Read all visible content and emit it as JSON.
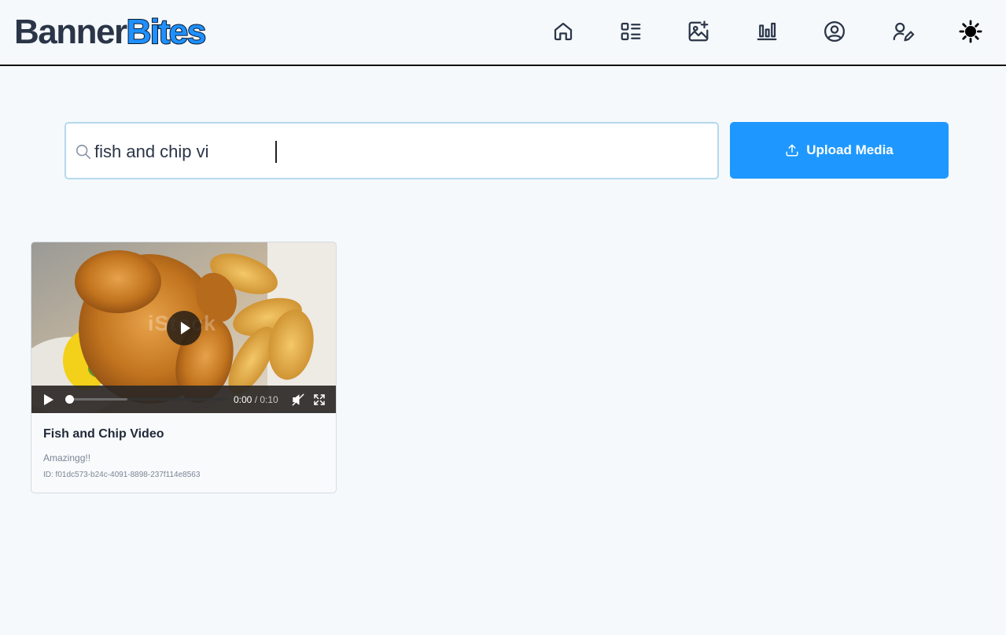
{
  "app": {
    "logo_part1": "Banner",
    "logo_part2": "Bites"
  },
  "nav": [
    {
      "name": "home-icon"
    },
    {
      "name": "dashboard-list-icon"
    },
    {
      "name": "image-add-icon"
    },
    {
      "name": "bar-chart-icon"
    },
    {
      "name": "user-circle-icon"
    },
    {
      "name": "user-edit-icon"
    },
    {
      "name": "sun-icon"
    }
  ],
  "search": {
    "value": "fish and chip vi",
    "placeholder": ""
  },
  "upload": {
    "label": "Upload Media"
  },
  "colors": {
    "accent": "#1e98ff",
    "background": "#f5f9fc"
  },
  "media": [
    {
      "title": "Fish and Chip Video",
      "description": "Amazingg!!",
      "id_text": "ID: f01dc573-b24c-4091-8898-237f114e8563",
      "watermark": "iStock",
      "current_time": "0:00",
      "duration": "/ 0:10",
      "progress": 0.0,
      "buffered": 0.37,
      "muted": true
    }
  ]
}
